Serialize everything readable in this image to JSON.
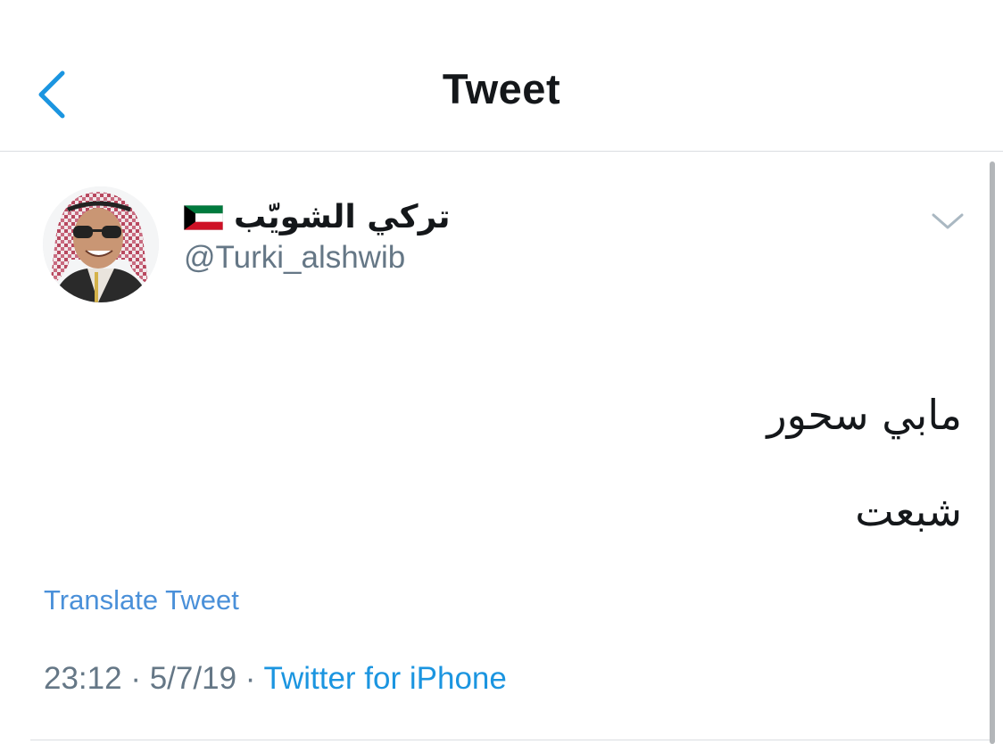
{
  "header": {
    "title": "Tweet",
    "back_icon": "chevron-left-icon"
  },
  "tweet": {
    "author": {
      "display_name": "تركي الشويّب",
      "flag": "kuwait-flag-icon",
      "handle": "@Turki_alshwib"
    },
    "menu_icon": "chevron-down-icon",
    "text_lines": [
      "مابي سحور",
      "شبعت"
    ],
    "translate_label": "Translate Tweet",
    "time": "23:12",
    "separator": "·",
    "date": "5/7/19",
    "source": "Twitter for iPhone"
  },
  "colors": {
    "accent": "#1b95e0",
    "text_primary": "#14171a",
    "text_secondary": "#657786",
    "divider": "#dadde1"
  }
}
